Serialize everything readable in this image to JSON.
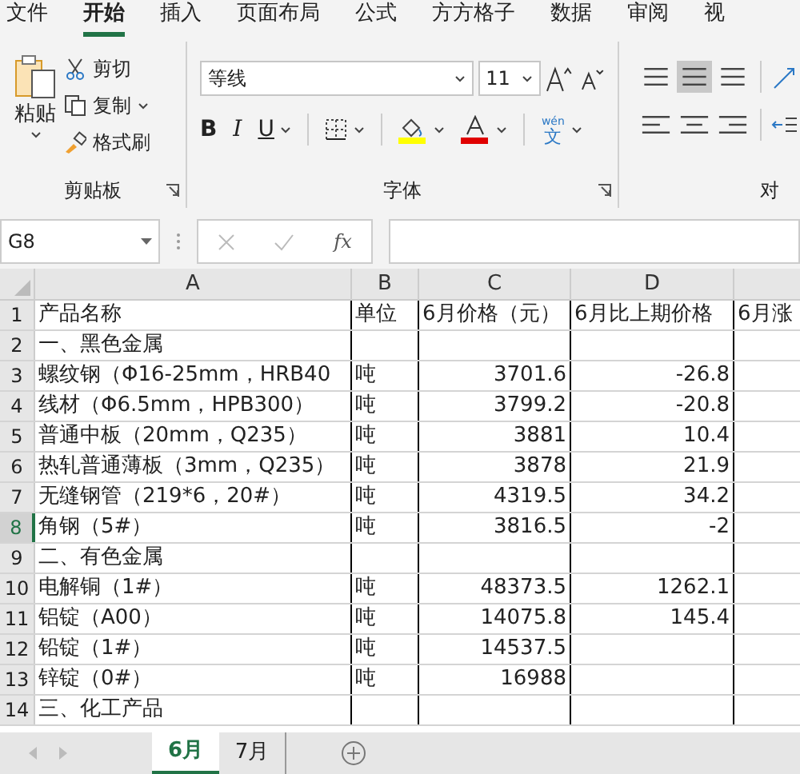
{
  "menu_tabs": [
    {
      "label": "文件",
      "selected": false
    },
    {
      "label": "开始",
      "selected": true
    },
    {
      "label": "插入",
      "selected": false
    },
    {
      "label": "页面布局",
      "selected": false
    },
    {
      "label": "公式",
      "selected": false
    },
    {
      "label": "方方格子",
      "selected": false
    },
    {
      "label": "数据",
      "selected": false
    },
    {
      "label": "审阅",
      "selected": false
    },
    {
      "label": "视",
      "selected": false
    }
  ],
  "clipboard": {
    "paste": "粘贴",
    "cut": "剪切",
    "copy": "复制",
    "format_painter": "格式刷",
    "group_label": "剪贴板"
  },
  "font": {
    "name": "等线",
    "size": "11",
    "bold": "B",
    "italic": "I",
    "underline": "U",
    "phonetic_top": "wén",
    "phonetic_bottom": "文",
    "group_label": "字体"
  },
  "alignment": {
    "group_label": "对"
  },
  "formula_bar": {
    "name_box": "G8",
    "function_label": "fx"
  },
  "columns": [
    "A",
    "B",
    "C",
    "D"
  ],
  "rows": [
    {
      "num": "1",
      "selected": false,
      "a": "产品名称",
      "b": "单位",
      "c": "6月价格（元）",
      "d": "6月比上期价格",
      "e": "6月涨"
    },
    {
      "num": "2",
      "selected": false,
      "a": "一、黑色金属"
    },
    {
      "num": "3",
      "selected": false,
      "a": "螺纹钢（Φ16-25mm，HRB40",
      "b": "吨",
      "c": "3701.6",
      "d": "-26.8"
    },
    {
      "num": "4",
      "selected": false,
      "a": "线材（Φ6.5mm，HPB300）",
      "b": "吨",
      "c": "3799.2",
      "d": "-20.8"
    },
    {
      "num": "5",
      "selected": false,
      "a": "普通中板（20mm，Q235）",
      "b": "吨",
      "c": "3881",
      "d": "10.4"
    },
    {
      "num": "6",
      "selected": false,
      "a": "热轧普通薄板（3mm，Q235）",
      "b": "吨",
      "c": "3878",
      "d": "21.9"
    },
    {
      "num": "7",
      "selected": false,
      "a": "无缝钢管（219*6，20#）",
      "b": "吨",
      "c": "4319.5",
      "d": "34.2"
    },
    {
      "num": "8",
      "selected": true,
      "a": "角钢（5#）",
      "b": "吨",
      "c": "3816.5",
      "d": "-2"
    },
    {
      "num": "9",
      "selected": false,
      "a": "二、有色金属"
    },
    {
      "num": "10",
      "selected": false,
      "a": "电解铜（1#）",
      "b": "吨",
      "c": "48373.5",
      "d": "1262.1"
    },
    {
      "num": "11",
      "selected": false,
      "a": "铝锭（A00）",
      "b": "吨",
      "c": "14075.8",
      "d": "145.4"
    },
    {
      "num": "12",
      "selected": false,
      "a": "铅锭（1#）",
      "b": "吨",
      "c": "14537.5"
    },
    {
      "num": "13",
      "selected": false,
      "a": "锌锭（0#）",
      "b": "吨",
      "c": "16988"
    },
    {
      "num": "14",
      "selected": false,
      "a": "三、化工产品"
    }
  ],
  "sheet_tabs": [
    {
      "label": "6月",
      "selected": true
    },
    {
      "label": "7月",
      "selected": false
    }
  ]
}
